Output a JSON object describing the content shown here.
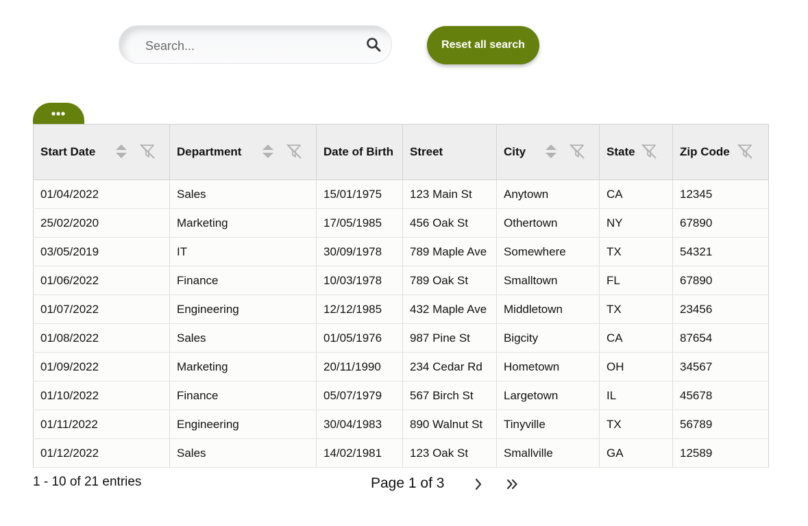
{
  "search": {
    "placeholder": "Search...",
    "value": ""
  },
  "toolbar": {
    "reset_label": "Reset all search"
  },
  "colors": {
    "accent": "#65800d",
    "header_bg": "#eeeeee",
    "icon_gray": "#b3b3b3"
  },
  "table": {
    "columns": [
      {
        "label": "Start Date",
        "sortable": true,
        "filterable": true
      },
      {
        "label": "Department",
        "sortable": true,
        "filterable": true
      },
      {
        "label": "Date of Birth",
        "sortable": false,
        "filterable": false
      },
      {
        "label": "Street",
        "sortable": false,
        "filterable": false
      },
      {
        "label": "City",
        "sortable": true,
        "filterable": true
      },
      {
        "label": "State",
        "sortable": false,
        "filterable": true
      },
      {
        "label": "Zip Code",
        "sortable": false,
        "filterable": true
      }
    ],
    "rows": [
      [
        "01/04/2022",
        "Sales",
        "15/01/1975",
        "123 Main St",
        "Anytown",
        "CA",
        "12345"
      ],
      [
        "25/02/2020",
        "Marketing",
        "17/05/1985",
        "456 Oak St",
        "Othertown",
        "NY",
        "67890"
      ],
      [
        "03/05/2019",
        "IT",
        "30/09/1978",
        "789 Maple Ave",
        "Somewhere",
        "TX",
        "54321"
      ],
      [
        "01/06/2022",
        "Finance",
        "10/03/1978",
        "789 Oak St",
        "Smalltown",
        "FL",
        "67890"
      ],
      [
        "01/07/2022",
        "Engineering",
        "12/12/1985",
        "432 Maple Ave",
        "Middletown",
        "TX",
        "23456"
      ],
      [
        "01/08/2022",
        "Sales",
        "01/05/1976",
        "987 Pine St",
        "Bigcity",
        "CA",
        "87654"
      ],
      [
        "01/09/2022",
        "Marketing",
        "20/11/1990",
        "234 Cedar Rd",
        "Hometown",
        "OH",
        "34567"
      ],
      [
        "01/10/2022",
        "Finance",
        "05/07/1979",
        "567 Birch St",
        "Largetown",
        "IL",
        "45678"
      ],
      [
        "01/11/2022",
        "Engineering",
        "30/04/1983",
        "890 Walnut St",
        "Tinyville",
        "TX",
        "56789"
      ],
      [
        "01/12/2022",
        "Sales",
        "14/02/1981",
        "123 Oak St",
        "Smallville",
        "GA",
        "12589"
      ]
    ]
  },
  "pagination": {
    "entries_label": "1 - 10 of 21 entries",
    "page_label": "Page 1 of 3",
    "next_icon": "chevron-right-icon",
    "last_icon": "double-chevron-right-icon"
  }
}
